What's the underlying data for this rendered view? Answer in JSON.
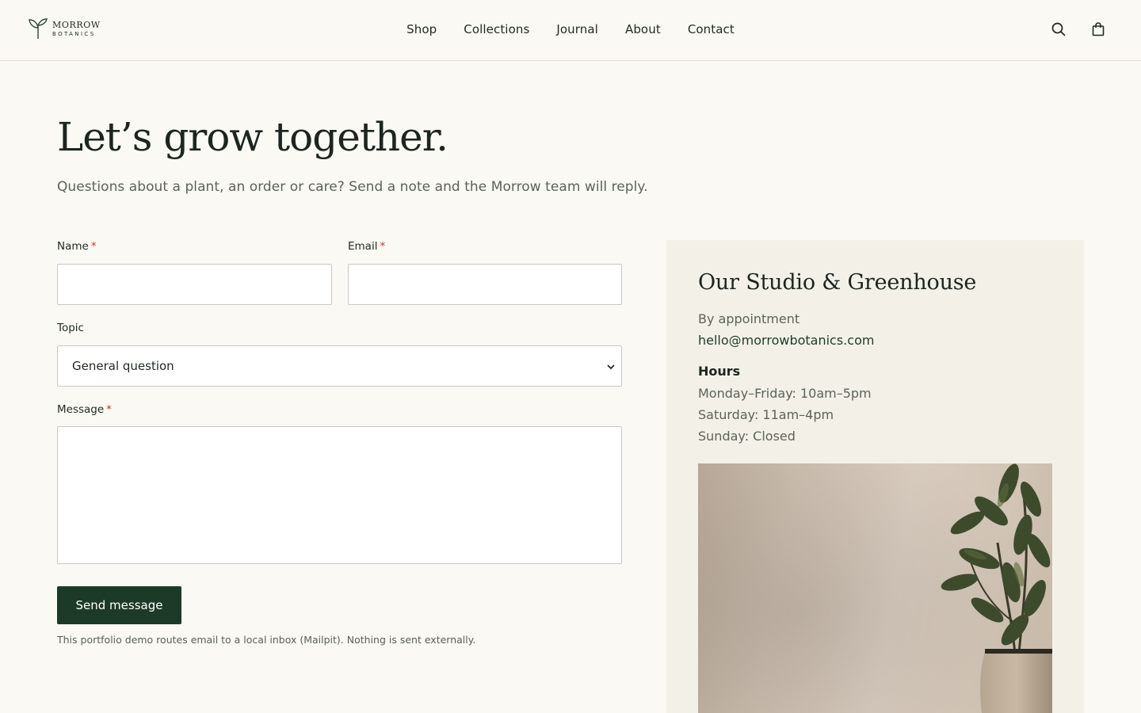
{
  "brand": {
    "name": "MORROW",
    "tagline": "BOTANICS"
  },
  "nav": {
    "items": [
      {
        "label": "Shop"
      },
      {
        "label": "Collections"
      },
      {
        "label": "Journal"
      },
      {
        "label": "About"
      },
      {
        "label": "Contact"
      }
    ],
    "icons": [
      "search-icon",
      "shopping-bag-icon"
    ]
  },
  "hero": {
    "title": "Let’s grow together.",
    "subtitle": "Questions about a plant, an order or care? Send a note and the Morrow team will reply."
  },
  "form": {
    "name_label": "Name",
    "email_label": "Email",
    "required_mark": "*",
    "name_value": "",
    "email_value": "",
    "topic_label": "Topic",
    "topic_selected": "General question",
    "message_label": "Message",
    "message_value": "",
    "submit_label": "Send message",
    "note": "This portfolio demo routes email to a local inbox (Mailpit). Nothing is sent externally."
  },
  "studio": {
    "title": "Our Studio & Greenhouse",
    "appointment": "By appointment",
    "email": "hello@morrowbotanics.com",
    "hours_heading": "Hours",
    "hours": [
      "Monday–Friday: 10am–5pm",
      "Saturday: 11am–4pm",
      "Sunday: Closed"
    ]
  },
  "colors": {
    "background": "#faf9f3",
    "card_background": "#f3f1e7",
    "accent": "#1d3a29",
    "required": "#c0392b",
    "muted_text": "#5c625c"
  }
}
